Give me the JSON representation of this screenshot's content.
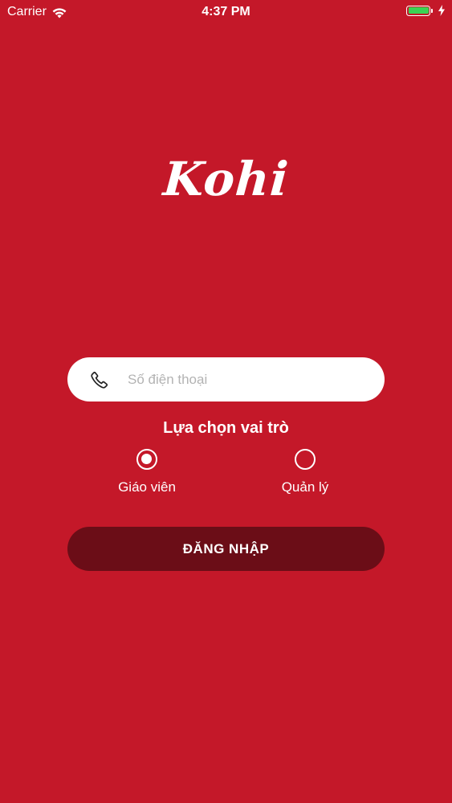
{
  "status_bar": {
    "carrier": "Carrier",
    "time": "4:37 PM",
    "battery_level": 1.0,
    "battery_color": "#39d353"
  },
  "app": {
    "logo_text": "Kohi",
    "background_color": "#c41829"
  },
  "login_form": {
    "phone_icon": "phone-icon",
    "phone_placeholder": "Số điện thoại",
    "phone_value": "",
    "role_title": "Lựa chọn vai trò",
    "roles": [
      {
        "label": "Giáo viên",
        "selected": true
      },
      {
        "label": "Quản lý",
        "selected": false
      }
    ],
    "login_label": "ĐĂNG NHẬP",
    "login_button_color": "#6b0d17"
  }
}
